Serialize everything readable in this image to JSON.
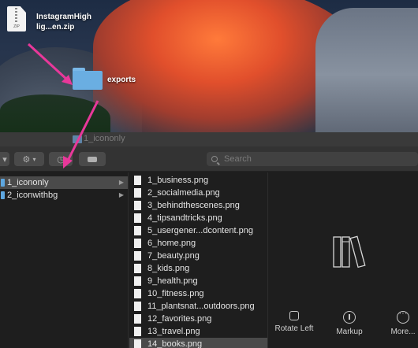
{
  "desktop": {
    "zip_file": {
      "name": "InstagramHighlig...en.zip",
      "badge": "ZIP"
    },
    "folder": {
      "name": "exports"
    }
  },
  "window": {
    "title": "1_icononly",
    "search_placeholder": "Search"
  },
  "sidebar_column": {
    "items": [
      {
        "label": "1_icononly",
        "selected": true
      },
      {
        "label": "2_iconwithbg",
        "selected": false
      }
    ]
  },
  "files_column": {
    "items": [
      "1_business.png",
      "2_socialmedia.png",
      "3_behindthescenes.png",
      "4_tipsandtricks.png",
      "5_usergener...dcontent.png",
      "6_home.png",
      "7_beauty.png",
      "8_kids.png",
      "9_health.png",
      "10_fitness.png",
      "11_plantsnat...outdoors.png",
      "12_favorites.png",
      "13_travel.png",
      "14_books.png"
    ],
    "selected": "14_books.png"
  },
  "preview": {
    "actions": {
      "rotate": "Rotate Left",
      "markup": "Markup",
      "more": "More..."
    }
  },
  "colors": {
    "accent": "#e8389a",
    "selection": "#4a4a4a",
    "folder": "#6aaee2"
  }
}
